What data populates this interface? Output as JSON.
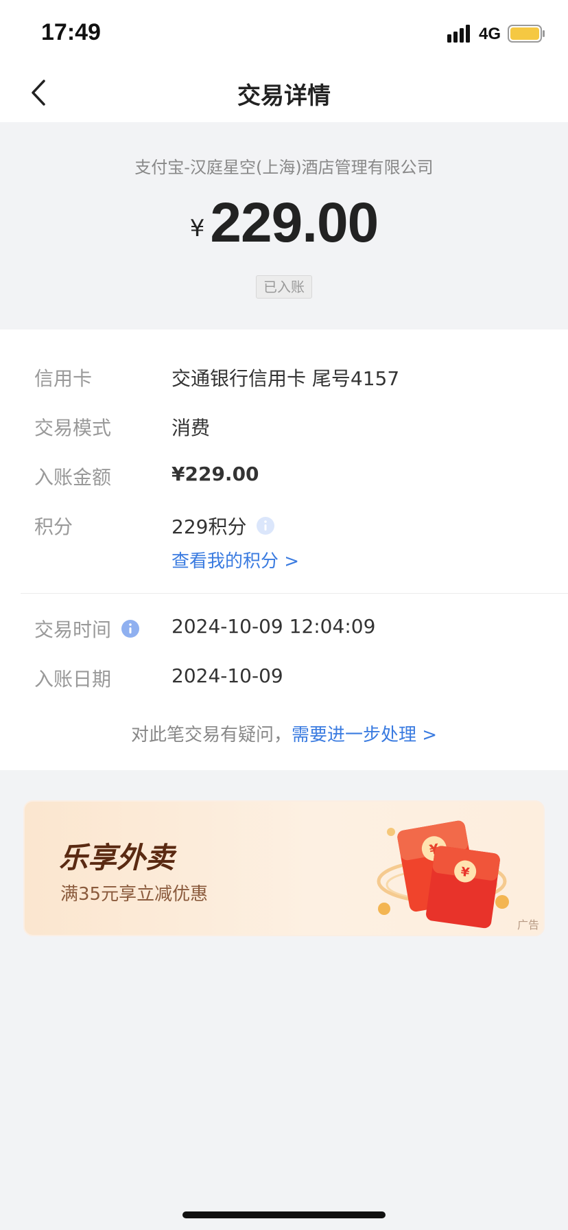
{
  "status_bar": {
    "time": "17:49",
    "network": "4G",
    "battery_color": "#f5c842"
  },
  "nav": {
    "title": "交易详情",
    "back_icon": "chevron-left-icon"
  },
  "summary": {
    "merchant": "支付宝-汉庭星空(上海)酒店管理有限公司",
    "currency_symbol": "¥",
    "amount": "229.00",
    "status": "已入账"
  },
  "details": {
    "card_label": "信用卡",
    "card_value": "交通银行信用卡 尾号4157",
    "mode_label": "交易模式",
    "mode_value": "消费",
    "posted_amount_label": "入账金额",
    "posted_amount_value": "¥229.00",
    "points_label": "积分",
    "points_value": "229积分",
    "points_link": "查看我的积分 >",
    "time_label": "交易时间",
    "time_value": "2024-10-09 12:04:09",
    "posting_date_label": "入账日期",
    "posting_date_value": "2024-10-09",
    "help_text": "对此笔交易有疑问，",
    "help_link": "需要进一步处理 >"
  },
  "ad": {
    "title": "乐享外卖",
    "subtitle": "满35元享立减优惠",
    "tag": "广告",
    "graphic": "red-envelope-icon"
  },
  "colors": {
    "link": "#3a7be0",
    "info_icon": "#8fb0f0",
    "info_icon_light": "#dbe6fb"
  }
}
